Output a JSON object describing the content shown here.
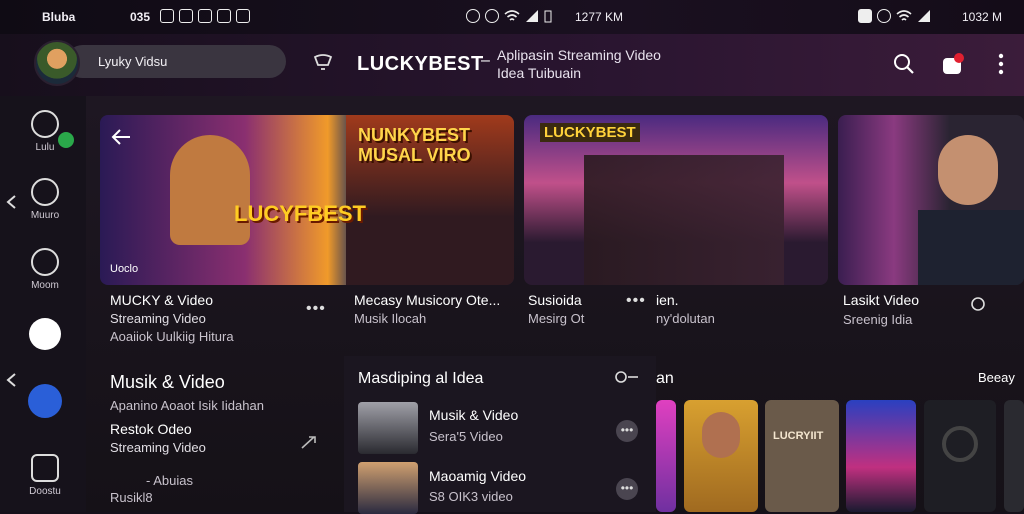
{
  "status_bar": {
    "left_label": "Bluba",
    "left_number": "035",
    "center_time": "1277 KM",
    "right_time": "1032 M"
  },
  "header": {
    "search_value": "Lyuky Vidsu",
    "brand": "LUCKYBEST",
    "dash": "–",
    "tagline_line1": "Aplipasin Streaming Video",
    "tagline_line2": "Idea Tuibuain"
  },
  "sidebar": {
    "items": [
      {
        "label": "Lulu",
        "icon": "smile-icon"
      },
      {
        "label": "Muuro",
        "icon": "book-icon"
      },
      {
        "label": "Moom",
        "icon": "tv-icon"
      },
      {
        "label": "",
        "icon": "avatar-badge-icon"
      },
      {
        "label": "",
        "icon": "bot-icon"
      },
      {
        "label": "Doostu",
        "icon": "square-icon"
      }
    ]
  },
  "featured": [
    {
      "thumb_title_a": "LUCYFBEST",
      "thumb_title_b": "NUNKYBEST MUSAL VIRO",
      "thumb_corner": "Uoclo",
      "title": "MUCKY & Video",
      "sub1": "Streaming Video",
      "sub2": "Aoaiiok Uulkiig Hitura"
    },
    {
      "title": "Mecasy Musicory Ote...",
      "sub1": "Musik Ilocah"
    },
    {
      "thumb_title": "LUCKYBEST",
      "title": "Susioida",
      "sub1": "Mesirg Ot",
      "title_b": "ien.",
      "sub_b": "ny'dolutan"
    },
    {
      "title": "Lasikt Video",
      "sub1": "Sreenig Idia"
    }
  ],
  "left_section": {
    "title": "Musik & Video",
    "sub": "Apanino Aoaot Isik Iidahan",
    "item_title": "Restok Odeo",
    "item_sub": "Streaming Video",
    "foot1": "- Abuias",
    "foot2": "Rusikl8"
  },
  "mid_section": {
    "title": "Masdiping al Idea",
    "items": [
      {
        "title": "Musik & Video",
        "sub": "Sera'5 Video"
      },
      {
        "title": "Maoamig Video",
        "sub": "S8 OIK3 video"
      }
    ]
  },
  "right_section": {
    "title_fragment": "an",
    "link": "Beeay",
    "tile_text": "LUCRYIIT"
  },
  "colors": {
    "accent_badge": "#2aa84a",
    "bg": "#15101a"
  }
}
